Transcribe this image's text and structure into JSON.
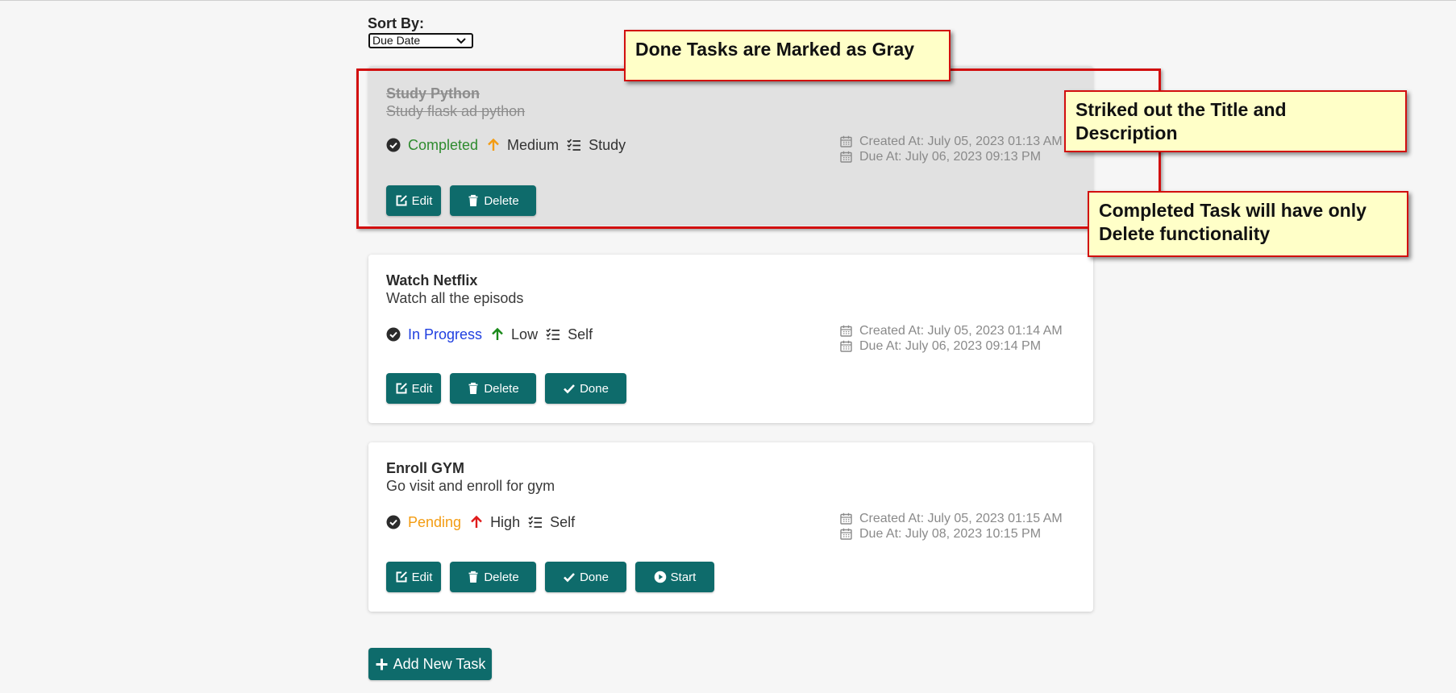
{
  "sort": {
    "label": "Sort By:",
    "selected": "Due Date"
  },
  "tasks": [
    {
      "title": "Study Python",
      "description": "Study flask ad python",
      "status": "Completed",
      "status_color": "#2e8b2e",
      "priority": "Medium",
      "priority_color": "#f39c12",
      "category": "Study",
      "created": "Created At: July 05, 2023 01:13 AM",
      "due": "Due At: July 06, 2023 09:13 PM",
      "buttons": {
        "edit": "Edit",
        "delete": "Delete"
      }
    },
    {
      "title": "Watch Netflix",
      "description": "Watch all the episods",
      "status": "In Progress",
      "status_color": "#1f3fe0",
      "priority": "Low",
      "priority_color": "#1a8a1a",
      "category": "Self",
      "created": "Created At: July 05, 2023 01:14 AM",
      "due": "Due At: July 06, 2023 09:14 PM",
      "buttons": {
        "edit": "Edit",
        "delete": "Delete",
        "done": "Done"
      }
    },
    {
      "title": "Enroll GYM",
      "description": "Go visit and enroll for gym",
      "status": "Pending",
      "status_color": "#f39c12",
      "priority": "High",
      "priority_color": "#e01b1b",
      "category": "Self",
      "created": "Created At: July 05, 2023 01:15 AM",
      "due": "Due At: July 08, 2023 10:15 PM",
      "buttons": {
        "edit": "Edit",
        "delete": "Delete",
        "done": "Done",
        "start": "Start"
      }
    }
  ],
  "add_task": "Add New Task",
  "annotations": {
    "gray": "Done Tasks are Marked as Gray",
    "strike_line1": "Striked out the Title and",
    "strike_line2": "Description",
    "delete_line1": "Completed Task will have only",
    "delete_line2": "Delete functionality"
  },
  "colors": {
    "button": "#0e6b6b",
    "annotation_border": "#d20f0f",
    "annotation_fill": "#ffffc8"
  }
}
